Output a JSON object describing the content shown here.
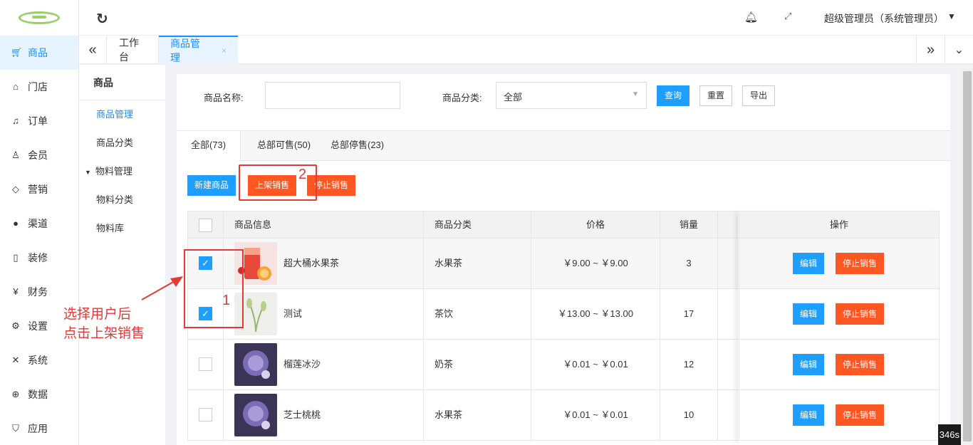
{
  "sidebar": {
    "items": [
      {
        "label": "商品",
        "icon": "cart-icon"
      },
      {
        "label": "门店",
        "icon": "home-icon"
      },
      {
        "label": "订单",
        "icon": "bell-icon"
      },
      {
        "label": "会员",
        "icon": "user-icon"
      },
      {
        "label": "营销",
        "icon": "cube-icon"
      },
      {
        "label": "渠道",
        "icon": "channel-icon"
      },
      {
        "label": "装修",
        "icon": "phone-icon"
      },
      {
        "label": "财务",
        "icon": "yen-icon"
      },
      {
        "label": "设置",
        "icon": "gear-icon"
      },
      {
        "label": "系统",
        "icon": "tools-icon"
      },
      {
        "label": "数据",
        "icon": "globe-icon"
      },
      {
        "label": "应用",
        "icon": "shield-icon"
      }
    ]
  },
  "header": {
    "user": "超级管理员（系统管理员）"
  },
  "tabs": {
    "t1": "工作台",
    "t2": "商品管理",
    "close": "×"
  },
  "subnav": {
    "title": "商品",
    "items": [
      "商品管理",
      "商品分类",
      "物料管理",
      "物料分类",
      "物料库"
    ]
  },
  "filter": {
    "name_label": "商品名称:",
    "name_value": "",
    "category_label": "商品分类:",
    "category_value": "全部",
    "query": "查询",
    "reset": "重置",
    "export": "导出"
  },
  "status_tabs": [
    "全部(73)",
    "总部可售(50)",
    "总部停售(23)"
  ],
  "actions": {
    "new": "新建商品",
    "on_sale": "上架销售",
    "stop_sale": "停止销售"
  },
  "table": {
    "headers": [
      "商品信息",
      "商品分类",
      "价格",
      "销量",
      "操作"
    ],
    "rows": [
      {
        "name": "超大桶水果茶",
        "category": "水果茶",
        "price": "￥9.00 ~ ￥9.00",
        "sales": "3",
        "checked": true
      },
      {
        "name": "测试",
        "category": "茶饮",
        "price": "￥13.00 ~ ￥13.00",
        "sales": "17",
        "checked": true
      },
      {
        "name": "榴莲冰沙",
        "category": "奶茶",
        "price": "￥0.01 ~ ￥0.01",
        "sales": "12",
        "checked": false
      },
      {
        "name": "芝士桃桃",
        "category": "水果茶",
        "price": "￥0.01 ~ ￥0.01",
        "sales": "10",
        "checked": false
      }
    ],
    "edit": "编辑",
    "stop": "停止销售"
  },
  "annotation": {
    "num1": "1",
    "num2": "2",
    "line1": "选择用户后",
    "line2": "点击上架销售"
  },
  "timer": "346s"
}
